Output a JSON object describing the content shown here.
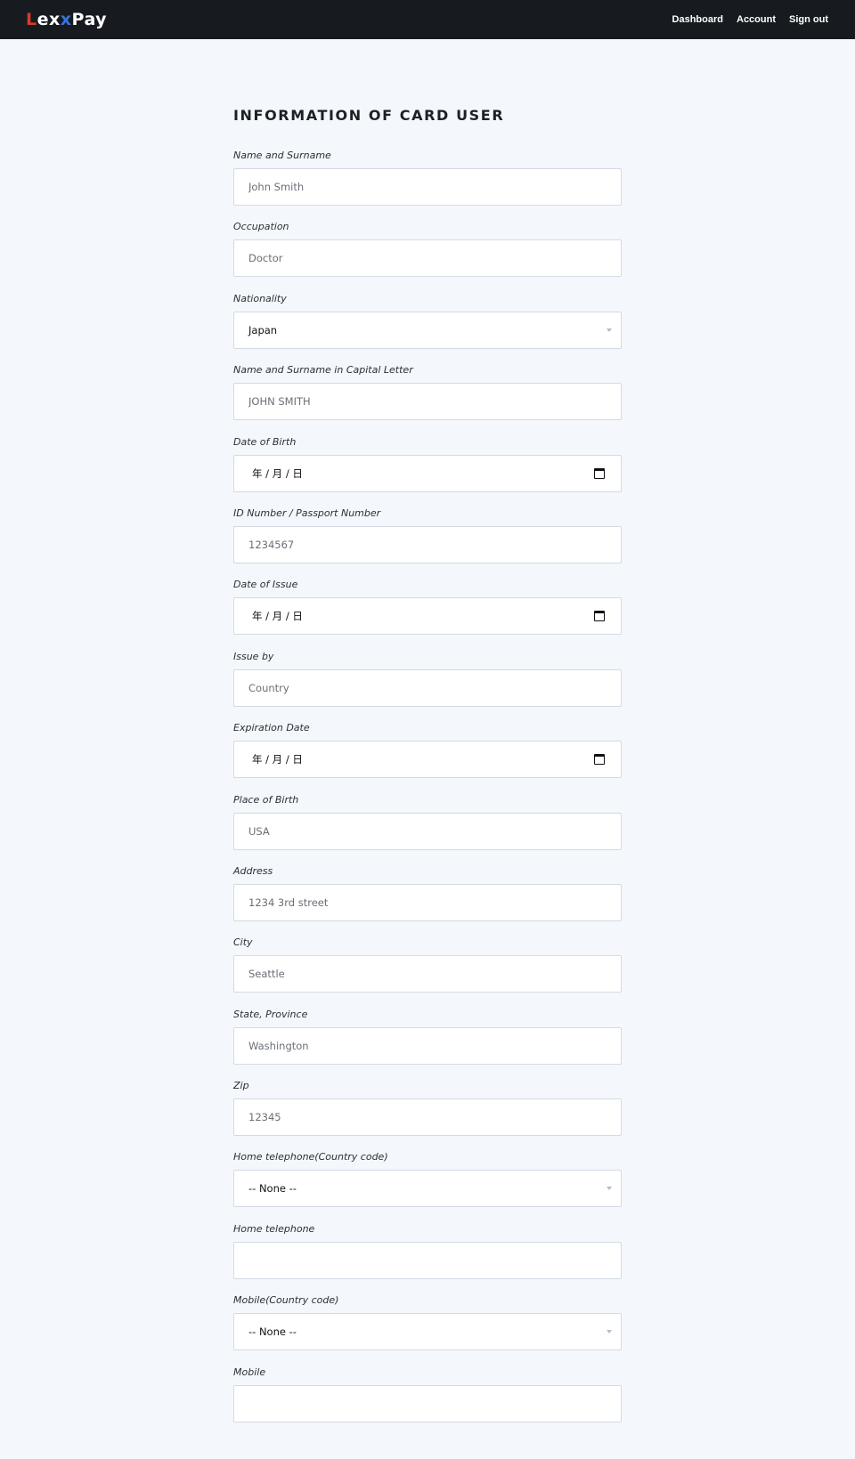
{
  "header": {
    "logo_parts": [
      "L",
      "ex",
      "x",
      "Pay"
    ],
    "nav": [
      {
        "label": "Dashboard"
      },
      {
        "label": "Account"
      },
      {
        "label": "Sign out"
      }
    ]
  },
  "form": {
    "title": "INFORMATION OF CARD USER",
    "fields": [
      {
        "label": "Name and Surname",
        "placeholder": "John Smith"
      },
      {
        "label": "Occupation",
        "placeholder": "Doctor"
      },
      {
        "label": "Nationality",
        "value": "Japan"
      },
      {
        "label": "Name and Surname in Capital Letter",
        "placeholder": "JOHN SMITH"
      },
      {
        "label": "Date of Birth",
        "value": "年 / 月 / 日"
      },
      {
        "label": "ID Number / Passport Number",
        "placeholder": "1234567"
      },
      {
        "label": "Date of Issue",
        "value": "年 / 月 / 日"
      },
      {
        "label": "Issue by",
        "placeholder": "Country"
      },
      {
        "label": "Expiration Date",
        "value": "年 / 月 / 日"
      },
      {
        "label": "Place of Birth",
        "placeholder": "USA"
      },
      {
        "label": "Address",
        "placeholder": "1234 3rd street"
      },
      {
        "label": "City",
        "placeholder": "Seattle"
      },
      {
        "label": "State, Province",
        "placeholder": "Washington"
      },
      {
        "label": "Zip",
        "placeholder": "12345"
      },
      {
        "label": "Home telephone(Country code)",
        "value": "-- None --"
      },
      {
        "label": "Home telephone",
        "placeholder": ""
      },
      {
        "label": "Mobile(Country code)",
        "value": "-- None --"
      },
      {
        "label": "Mobile",
        "placeholder": ""
      }
    ]
  },
  "icons": {
    "select": "chevron-down-icon",
    "date": "calendar-icon"
  }
}
